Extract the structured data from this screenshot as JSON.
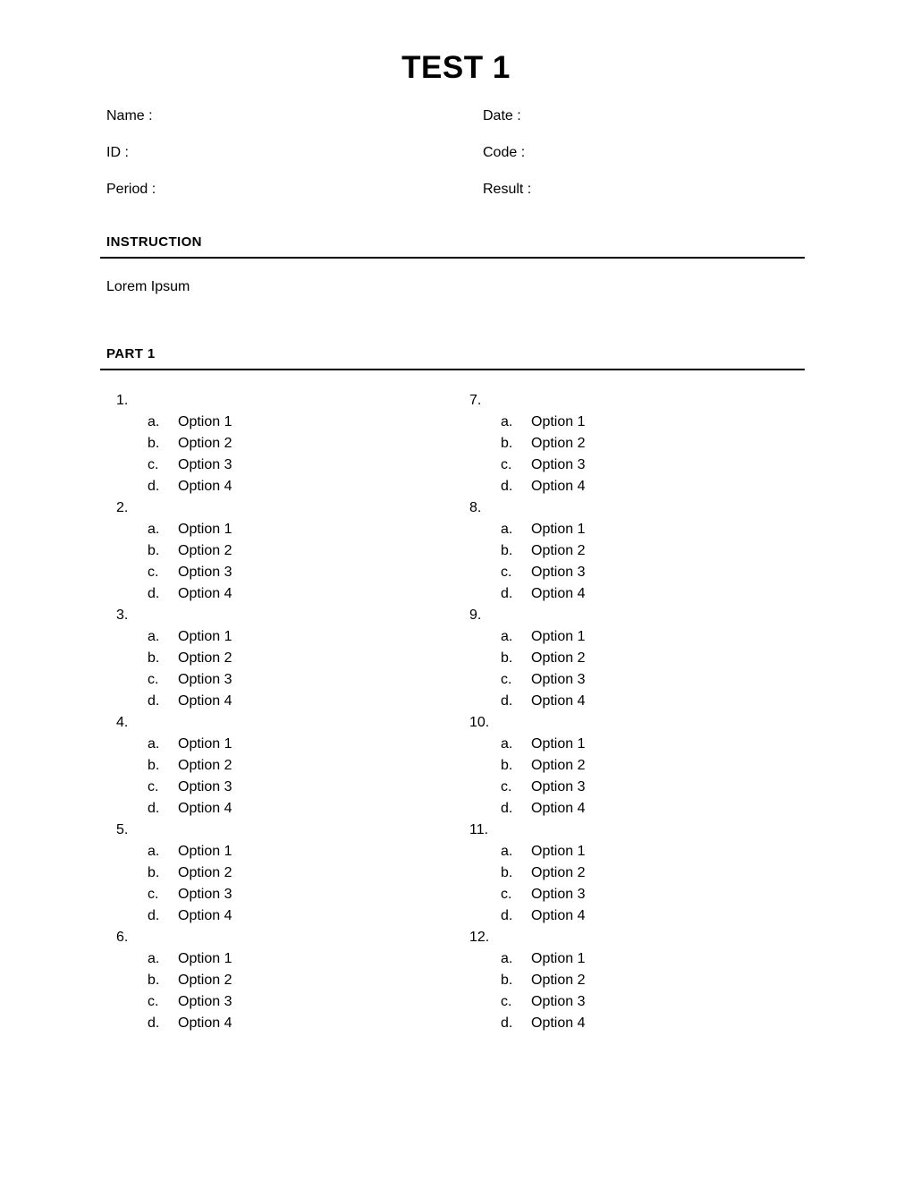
{
  "document": {
    "title": "TEST 1"
  },
  "meta": {
    "rows": [
      {
        "left_label": "Name :",
        "right_label": "Date :"
      },
      {
        "left_label": "ID :",
        "right_label": "Code :"
      },
      {
        "left_label": "Period :",
        "right_label": "Result :"
      }
    ]
  },
  "instruction": {
    "heading": "INSTRUCTION",
    "body": "Lorem Ipsum"
  },
  "part1": {
    "heading": "PART 1",
    "columns": [
      {
        "questions": [
          {
            "number": "1.",
            "options": [
              {
                "letter": "a.",
                "text": "Option 1"
              },
              {
                "letter": "b.",
                "text": "Option 2"
              },
              {
                "letter": "c.",
                "text": "Option 3"
              },
              {
                "letter": "d.",
                "text": "Option 4"
              }
            ]
          },
          {
            "number": "2.",
            "options": [
              {
                "letter": "a.",
                "text": "Option 1"
              },
              {
                "letter": "b.",
                "text": "Option 2"
              },
              {
                "letter": "c.",
                "text": "Option 3"
              },
              {
                "letter": "d.",
                "text": "Option 4"
              }
            ]
          },
          {
            "number": "3.",
            "options": [
              {
                "letter": "a.",
                "text": "Option 1"
              },
              {
                "letter": "b.",
                "text": "Option 2"
              },
              {
                "letter": "c.",
                "text": "Option 3"
              },
              {
                "letter": "d.",
                "text": "Option 4"
              }
            ]
          },
          {
            "number": "4.",
            "options": [
              {
                "letter": "a.",
                "text": "Option 1"
              },
              {
                "letter": "b.",
                "text": "Option 2"
              },
              {
                "letter": "c.",
                "text": "Option 3"
              },
              {
                "letter": "d.",
                "text": "Option 4"
              }
            ]
          },
          {
            "number": "5.",
            "options": [
              {
                "letter": "a.",
                "text": "Option 1"
              },
              {
                "letter": "b.",
                "text": "Option 2"
              },
              {
                "letter": "c.",
                "text": "Option 3"
              },
              {
                "letter": "d.",
                "text": "Option 4"
              }
            ]
          },
          {
            "number": "6.",
            "options": [
              {
                "letter": "a.",
                "text": "Option 1"
              },
              {
                "letter": "b.",
                "text": "Option 2"
              },
              {
                "letter": "c.",
                "text": "Option 3"
              },
              {
                "letter": "d.",
                "text": "Option 4"
              }
            ]
          }
        ]
      },
      {
        "questions": [
          {
            "number": "7.",
            "options": [
              {
                "letter": "a.",
                "text": "Option 1"
              },
              {
                "letter": "b.",
                "text": "Option 2"
              },
              {
                "letter": "c.",
                "text": "Option 3"
              },
              {
                "letter": "d.",
                "text": "Option 4"
              }
            ]
          },
          {
            "number": "8.",
            "options": [
              {
                "letter": "a.",
                "text": "Option 1"
              },
              {
                "letter": "b.",
                "text": "Option 2"
              },
              {
                "letter": "c.",
                "text": "Option 3"
              },
              {
                "letter": "d.",
                "text": "Option 4"
              }
            ]
          },
          {
            "number": "9.",
            "options": [
              {
                "letter": "a.",
                "text": "Option 1"
              },
              {
                "letter": "b.",
                "text": "Option 2"
              },
              {
                "letter": "c.",
                "text": "Option 3"
              },
              {
                "letter": "d.",
                "text": "Option 4"
              }
            ]
          },
          {
            "number": "10.",
            "options": [
              {
                "letter": "a.",
                "text": "Option 1"
              },
              {
                "letter": "b.",
                "text": "Option 2"
              },
              {
                "letter": "c.",
                "text": "Option 3"
              },
              {
                "letter": "d.",
                "text": "Option 4"
              }
            ]
          },
          {
            "number": "11.",
            "options": [
              {
                "letter": "a.",
                "text": "Option 1"
              },
              {
                "letter": "b.",
                "text": "Option 2"
              },
              {
                "letter": "c.",
                "text": "Option 3"
              },
              {
                "letter": "d.",
                "text": "Option 4"
              }
            ]
          },
          {
            "number": "12.",
            "options": [
              {
                "letter": "a.",
                "text": "Option 1"
              },
              {
                "letter": "b.",
                "text": "Option 2"
              },
              {
                "letter": "c.",
                "text": "Option 3"
              },
              {
                "letter": "d.",
                "text": "Option 4"
              }
            ]
          }
        ]
      }
    ]
  }
}
